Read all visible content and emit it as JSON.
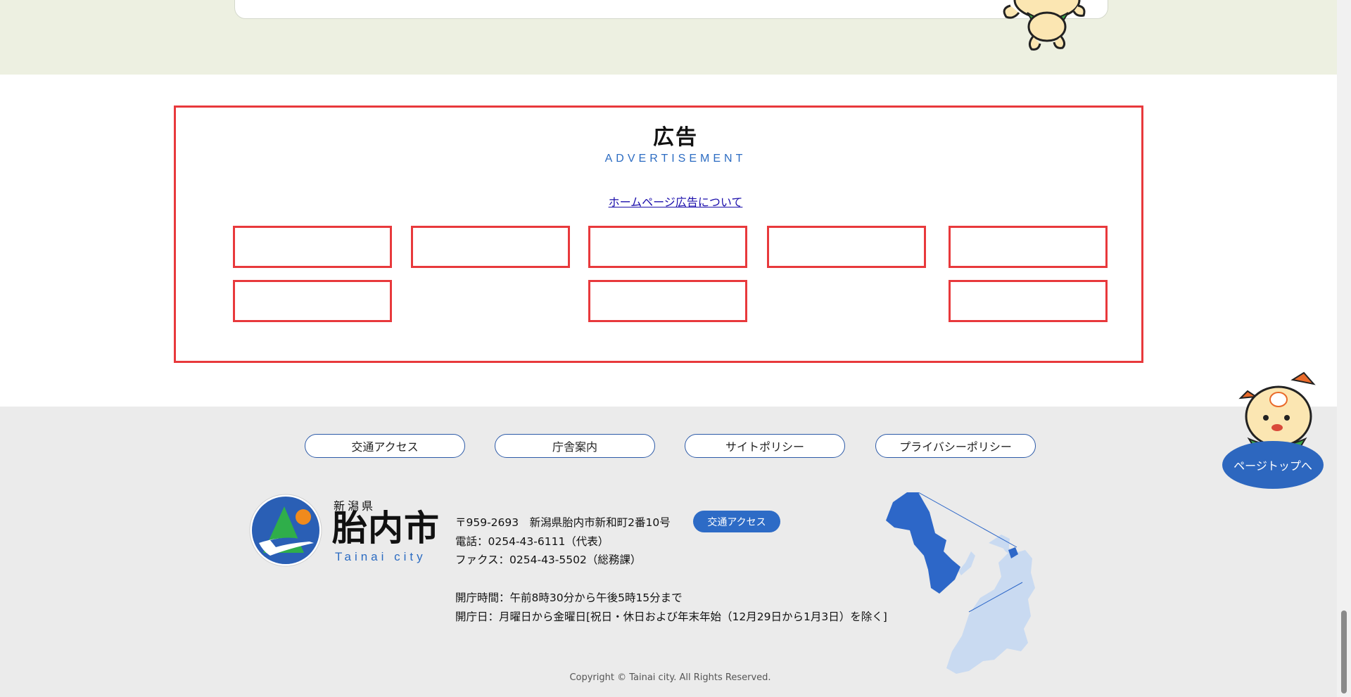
{
  "advertisement": {
    "title": "広告",
    "subtitle": "ADVERTISEMENT",
    "link_label": "ホームページ広告について"
  },
  "footer": {
    "nav": [
      "交通アクセス",
      "庁舎案内",
      "サイトポリシー",
      "プライバシーポリシー"
    ],
    "logo": {
      "prefecture": "新潟県",
      "city": "胎内市",
      "english": "Tainai city"
    },
    "address": "〒959-2693　新潟県胎内市新和町2番10号",
    "access_button": "交通アクセス",
    "phone": "電話：0254-43-6111（代表）",
    "fax": "ファクス：0254-43-5502（総務課）",
    "hours": "開庁時間：午前8時30分から午後5時15分まで",
    "days": "開庁日：月曜日から金曜日[祝日・休日および年末年始（12月29日から1月3日）を除く]",
    "copyright": "Copyright © Tainai city. All Rights Reserved."
  },
  "page_top": {
    "label": "ページトップへ"
  },
  "colors": {
    "accent": "#2d6bc6",
    "ad_border": "#e8393c",
    "footer_bg": "#ebebeb",
    "top_band": "#edf0e1"
  }
}
